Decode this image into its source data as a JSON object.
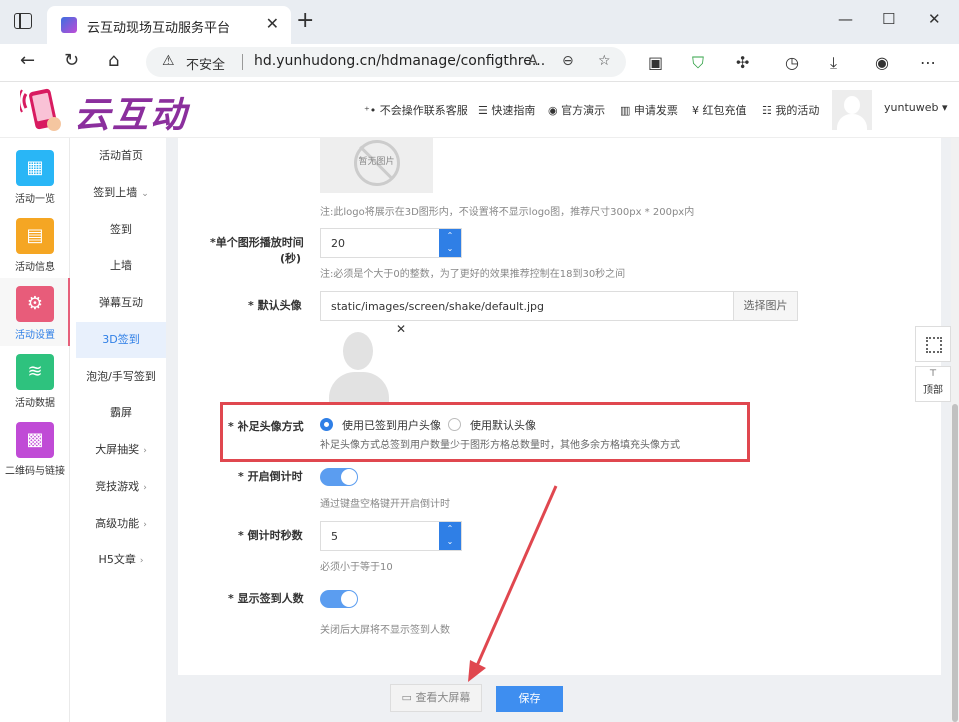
{
  "browser": {
    "tab_title": "云互动现场互动服务平台",
    "insecure_label": "不安全",
    "url": "hd.yunhudong.cn/hdmanage/configthre..."
  },
  "header": {
    "logo_text": "云互动",
    "links": [
      "不会操作联系客服",
      "快速指南",
      "官方演示",
      "申请发票",
      "红包充值",
      "我的活动"
    ],
    "username": "yuntuweb"
  },
  "sidebar": {
    "items": [
      {
        "label": "活动一览",
        "color": "#29b6f6"
      },
      {
        "label": "活动信息",
        "color": "#f5a623"
      },
      {
        "label": "活动设置",
        "color": "#e85c7a"
      },
      {
        "label": "活动数据",
        "color": "#2ec27e"
      },
      {
        "label": "二维码与链接",
        "color": "#c04bd6"
      }
    ]
  },
  "submenu": {
    "items": [
      "活动首页",
      "签到上墙",
      "签到",
      "上墙",
      "弹幕互动",
      "3D签到",
      "泡泡/手写签到",
      "霸屏",
      "大屏抽奖",
      "竞技游戏",
      "高级功能",
      "H5文章"
    ]
  },
  "form": {
    "no_image_text": "暂无图片",
    "logo_hint": "注:此logo将展示在3D图形内，不设置将不显示logo图，推荐尺寸300px * 200px内",
    "duration_label": "*单个图形播放时间",
    "duration_unit": "(秒)",
    "duration_value": "20",
    "duration_hint": "注:必须是个大于0的整数，为了更好的效果推荐控制在18到30秒之间",
    "avatar_label": "* 默认头像",
    "avatar_path": "static/images/screen/shake/default.jpg",
    "pick_image": "选择图片",
    "fill_label": "* 补足头像方式",
    "fill_option_1": "使用已签到用户头像",
    "fill_option_2": "使用默认头像",
    "fill_hint": "补足头像方式总签到用户数量少于图形方格总数量时，其他多余方格填充头像方式",
    "countdown_label": "* 开启倒计时",
    "countdown_hint": "通过键盘空格键开开启倒计时",
    "countdown_sec_label": "* 倒计时秒数",
    "countdown_sec_value": "5",
    "countdown_sec_hint": "必须小于等于10",
    "show_count_label": "* 显示签到人数",
    "show_count_hint": "关闭后大屏将不显示签到人数"
  },
  "float": {
    "top_label": "顶部"
  },
  "footer": {
    "preview_label": "查看大屏幕",
    "save_label": "保存"
  }
}
